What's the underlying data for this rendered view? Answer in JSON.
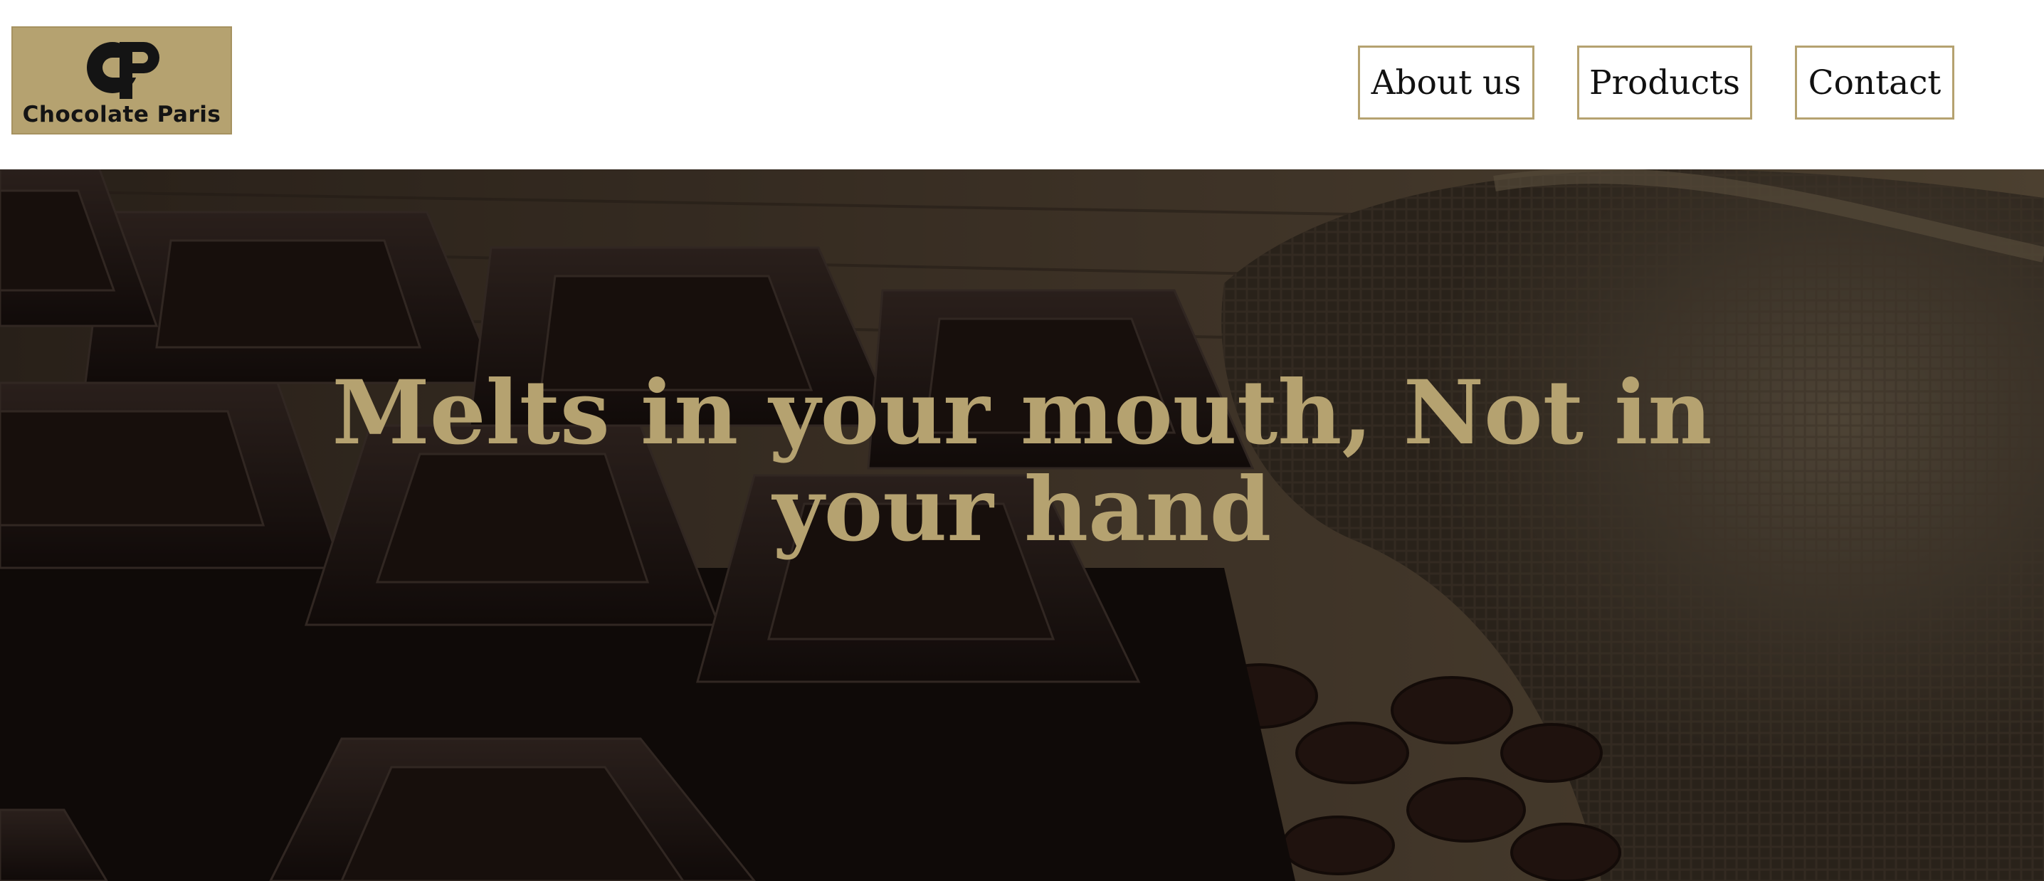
{
  "header": {
    "logo": {
      "monogram": "CP",
      "text": "Chocolate Paris"
    },
    "nav": [
      {
        "label": "About us"
      },
      {
        "label": "Products"
      },
      {
        "label": "Contact"
      }
    ]
  },
  "hero": {
    "tagline": "Melts in your mouth, Not in your hand"
  },
  "colors": {
    "accent": "#b5a270",
    "nav_text": "#111111",
    "header_bg": "#ffffff"
  }
}
